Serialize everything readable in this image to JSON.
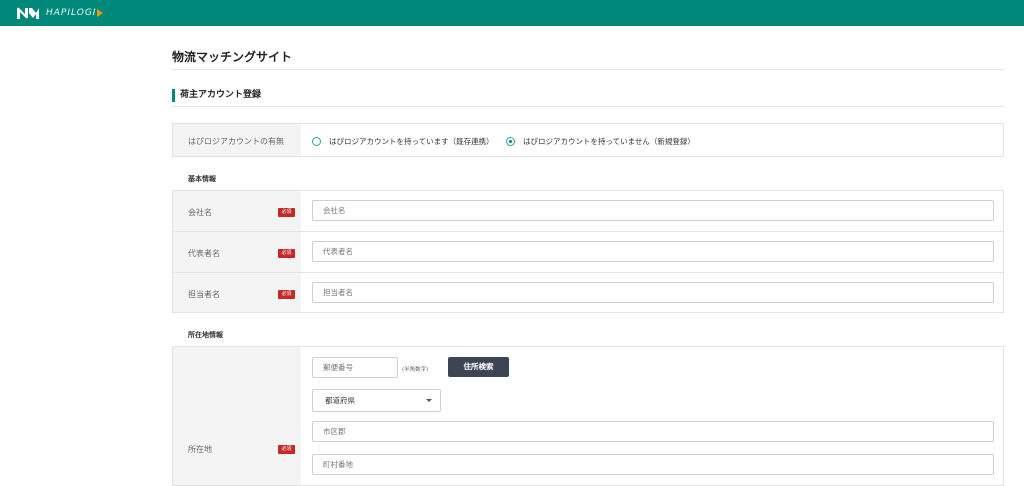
{
  "header": {
    "brand": "HAPILOGI",
    "accent_color": "#00897b",
    "logo_icon": "hapilogi-logo-icon"
  },
  "page_title": "物流マッチングサイト",
  "section_title": "荷主アカウント登録",
  "account_row": {
    "label": "はぴロジアカウントの有無",
    "options": [
      {
        "label": "はぴロジアカウントを持っています（既存連携）",
        "checked": false
      },
      {
        "label": "はぴロジアカウントを持っていません（新規登録）",
        "checked": true
      }
    ]
  },
  "basic_info": {
    "heading": "基本情報",
    "required_badge": "必須",
    "fields": [
      {
        "label": "会社名",
        "placeholder": "会社名"
      },
      {
        "label": "代表者名",
        "placeholder": "代表者名"
      },
      {
        "label": "担当者名",
        "placeholder": "担当者名"
      }
    ]
  },
  "location_info": {
    "heading": "所在地情報",
    "label": "所在地",
    "required_badge": "必須",
    "postal_placeholder": "郵便番号",
    "postal_note": "(半角数字)",
    "search_button": "住所検索",
    "prefecture_value": "都道府県",
    "city_placeholder": "市区郡",
    "town_placeholder": "町村番地"
  }
}
